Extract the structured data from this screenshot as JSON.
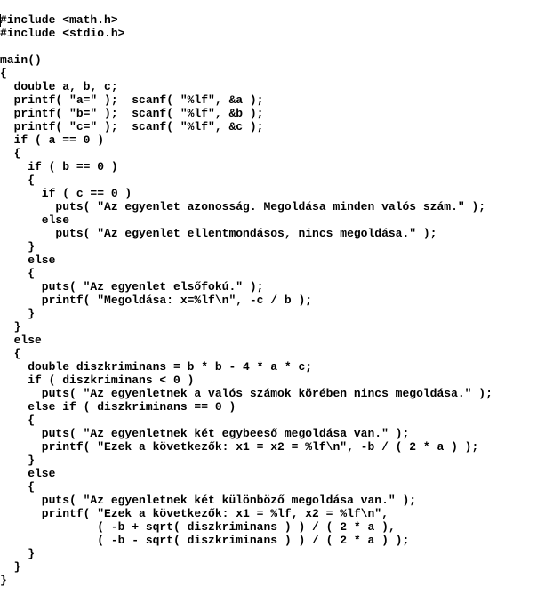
{
  "code": {
    "lines": [
      "#include <math.h>",
      "#include <stdio.h>",
      "",
      "main()",
      "{",
      "  double a, b, c;",
      "  printf( \"a=\" );  scanf( \"%lf\", &a );",
      "  printf( \"b=\" );  scanf( \"%lf\", &b );",
      "  printf( \"c=\" );  scanf( \"%lf\", &c );",
      "  if ( a == 0 )",
      "  {",
      "    if ( b == 0 )",
      "    {",
      "      if ( c == 0 )",
      "        puts( \"Az egyenlet azonosság. Megoldása minden valós szám.\" );",
      "      else",
      "        puts( \"Az egyenlet ellentmondásos, nincs megoldása.\" );",
      "    }",
      "    else",
      "    {",
      "      puts( \"Az egyenlet elsőfokú.\" );",
      "      printf( \"Megoldása: x=%lf\\n\", -c / b );",
      "    }",
      "  }",
      "  else",
      "  {",
      "    double diszkriminans = b * b - 4 * a * c;",
      "    if ( diszkriminans < 0 )",
      "      puts( \"Az egyenletnek a valós számok körében nincs megoldása.\" );",
      "    else if ( diszkriminans == 0 )",
      "    {",
      "      puts( \"Az egyenletnek két egybeeső megoldása van.\" );",
      "      printf( \"Ezek a következők: x1 = x2 = %lf\\n\", -b / ( 2 * a ) );",
      "    }",
      "    else",
      "    {",
      "      puts( \"Az egyenletnek két különböző megoldása van.\" );",
      "      printf( \"Ezek a következők: x1 = %lf, x2 = %lf\\n\",",
      "              ( -b + sqrt( diszkriminans ) ) / ( 2 * a ),",
      "              ( -b - sqrt( diszkriminans ) ) / ( 2 * a ) );",
      "    }",
      "  }",
      "}"
    ]
  }
}
